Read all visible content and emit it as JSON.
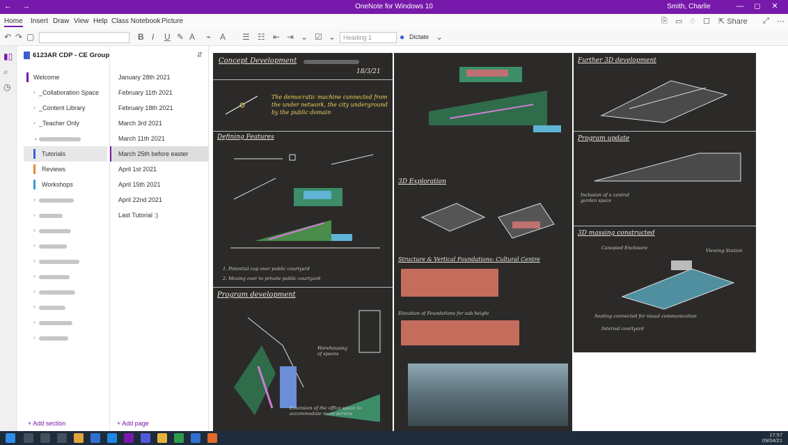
{
  "titlebar": {
    "nav": "← →",
    "title": "OneNote for Windows 10",
    "user": "Smith, Charlie",
    "minimize": "—",
    "maximize": "◻",
    "close": "✕"
  },
  "menu": {
    "tabs": [
      "Home",
      "Insert",
      "Draw",
      "View",
      "Help",
      "Class Notebook",
      "Picture"
    ],
    "share": "Share"
  },
  "ribbon": {
    "heading_style": "Heading 1",
    "dictate": "Dictate"
  },
  "notebook": {
    "name": "6123AR CDP - CE Group"
  },
  "sections": [
    {
      "label": "Welcome",
      "color": "#7719aa",
      "type": "tab"
    },
    {
      "label": "_Collaboration Space",
      "type": "group"
    },
    {
      "label": "_Content Library",
      "type": "group"
    },
    {
      "label": "_Teacher Only",
      "type": "group"
    },
    {
      "label": "",
      "type": "group-open",
      "blurred": true
    },
    {
      "label": "Tutorials",
      "color": "#3a5ed8",
      "type": "sub",
      "selected": true
    },
    {
      "label": "Reviews",
      "color": "#e08a3c",
      "type": "sub"
    },
    {
      "label": "Workshops",
      "color": "#3a9ad8",
      "type": "sub"
    },
    {
      "label": "",
      "type": "group",
      "blurred": true
    },
    {
      "label": "",
      "type": "group",
      "blurred": true
    },
    {
      "label": "",
      "type": "group",
      "blurred": true
    },
    {
      "label": "",
      "type": "group",
      "blurred": true
    },
    {
      "label": "",
      "type": "group",
      "blurred": true
    },
    {
      "label": "",
      "type": "group",
      "blurred": true
    },
    {
      "label": "",
      "type": "group",
      "blurred": true
    },
    {
      "label": "",
      "type": "group",
      "blurred": true
    },
    {
      "label": "",
      "type": "group",
      "blurred": true
    },
    {
      "label": "",
      "type": "group",
      "blurred": true
    }
  ],
  "pages": [
    {
      "label": "January 28th 2021"
    },
    {
      "label": "February 11th 2021"
    },
    {
      "label": "February 18th 2021"
    },
    {
      "label": "March 3rd 2021"
    },
    {
      "label": "March 11th 2021"
    },
    {
      "label": "March 25th before easter",
      "selected": true
    },
    {
      "label": "April 1st 2021"
    },
    {
      "label": "April 15th 2021"
    },
    {
      "label": "April 22nd 2021"
    },
    {
      "label": "Last Tutorial :)"
    }
  ],
  "add_section": "+ Add section",
  "add_page": "+ Add page",
  "board": {
    "title_left": "Concept Development",
    "date": "18/3/21",
    "concept_note": "The democratic machine connected from the under network, the city underground by the public domain",
    "defining_features": "Defining Features",
    "pathway": "1. Potential cup over public courtyard",
    "pathway2": "2. Moving over to private public courtyard",
    "program_dev": "Program development",
    "workspace_note": "Warehousing of spaces",
    "extension_note": "Extension of the office space to accommodate more service",
    "sd_exploration": "3D Exploration",
    "section_title": "Structure & Vertical Foundations: Cultural Centre",
    "elevation_note": "Elevation of Foundations for sub height",
    "further_3d": "Further 3D development",
    "program_update": "Program update",
    "inclusion_note": "Inclusion of a central garden space",
    "massing": "3D massing constructed",
    "viewing": "Viewing Station",
    "canopy": "Canopied Enclosure",
    "seating": "Seating connected for visual communication",
    "courtyard": "Internal courtyard"
  },
  "taskbar": {
    "time": "17:57",
    "date": "09/04/21"
  }
}
